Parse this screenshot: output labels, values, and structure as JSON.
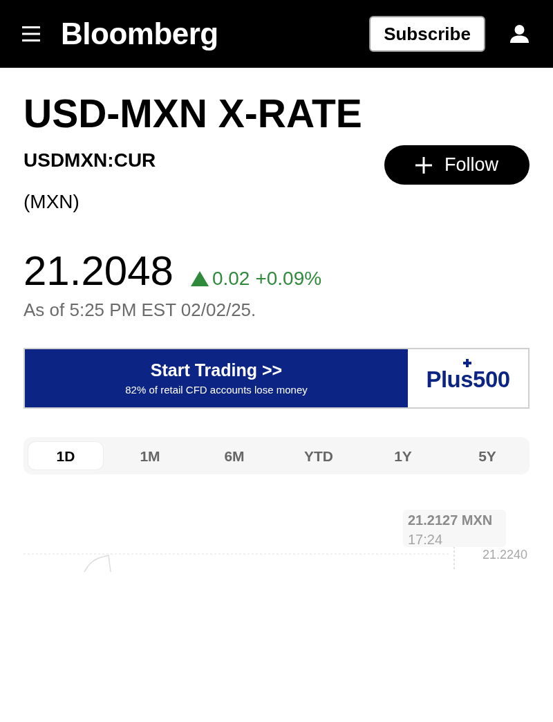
{
  "header": {
    "logo": "Bloomberg",
    "subscribe_button": "Subscribe"
  },
  "instrument": {
    "title": "USD-MXN X-RATE",
    "ticker": "USDMXN:CUR",
    "currency": "(MXN)",
    "follow_button": "Follow"
  },
  "quote": {
    "price": "21.2048",
    "up": true,
    "change": "0.02",
    "change_percent": "+0.09%",
    "as_of": "As of 5:25 PM EST 02/02/25."
  },
  "ad": {
    "headline": "Start Trading >>",
    "disclaimer": "82% of retail CFD accounts lose money",
    "brand": "Plus500"
  },
  "range_tabs": [
    {
      "label": "1D",
      "selected": true
    },
    {
      "label": "1M",
      "selected": false
    },
    {
      "label": "6M",
      "selected": false
    },
    {
      "label": "YTD",
      "selected": false
    },
    {
      "label": "1Y",
      "selected": false
    },
    {
      "label": "5Y",
      "selected": false
    }
  ],
  "chart": {
    "tooltip_value": "21.2127 MXN",
    "tooltip_time": "17:24",
    "axis_label": "21.2240"
  }
}
